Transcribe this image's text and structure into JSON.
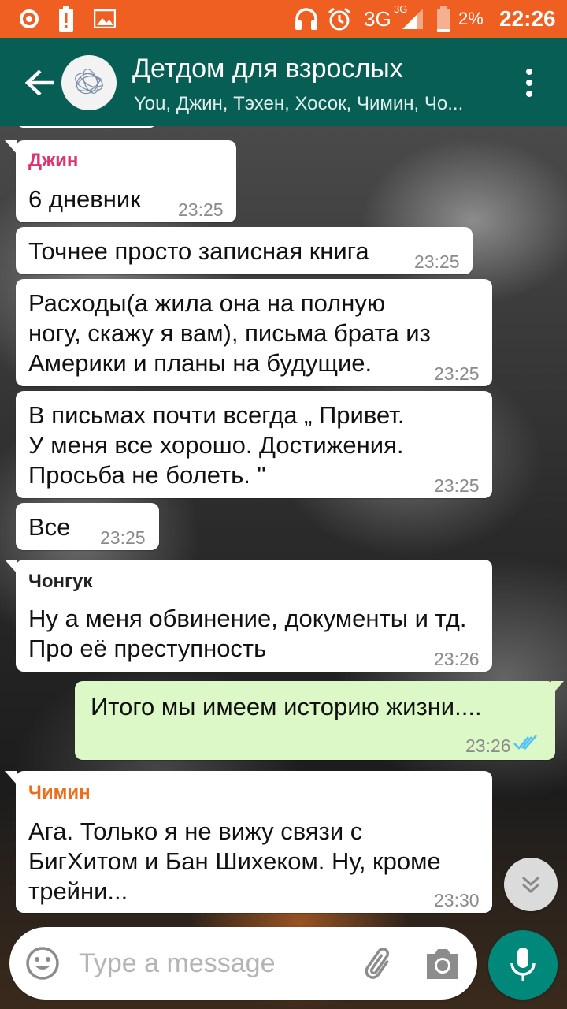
{
  "status_bar": {
    "network": "3G",
    "network_sup": "3G",
    "battery": "2%",
    "time": "22:26"
  },
  "chat": {
    "title": "Детдом для взрослых",
    "participants": "You, Джин, Тэхен, Хосок, Чимин, Чо..."
  },
  "messages": [
    {
      "sender": "Джин",
      "sender_color": "#e0336e",
      "lines": [
        "6 дневник"
      ],
      "time": "23:25"
    },
    {
      "lines": [
        "Точнее просто записная книга"
      ],
      "time": "23:25"
    },
    {
      "lines": [
        "Расходы(а жила она на полную",
        "ногу, скажу я вам), письма брата из",
        "Америки и планы на будущие."
      ],
      "time": "23:25"
    },
    {
      "lines": [
        "В письмах почти всегда „ Привет.",
        "У меня все хорошо. Достижения.",
        "Просьба не болеть. \""
      ],
      "time": "23:25"
    },
    {
      "lines": [
        "Все"
      ],
      "time": "23:25"
    },
    {
      "sender": "Чонгук",
      "sender_color": "#222222",
      "lines": [
        "Ну а меня обвинение, документы и тд.",
        "Про её преступность"
      ],
      "time": "23:26"
    },
    {
      "outgoing": true,
      "lines": [
        "Итого мы имеем историю жизни...."
      ],
      "time": "23:26",
      "status": "read"
    },
    {
      "sender": "Чимин",
      "sender_color": "#ef6c1a",
      "lines": [
        "Ага. Только я не вижу связи с",
        "БигХитом и Бан Шихеком. Ну, кроме",
        "трейни..."
      ],
      "time": "23:30"
    }
  ],
  "composer": {
    "placeholder": "Type a message"
  },
  "colors": {
    "status_bar": "#ef5f22",
    "header": "#075e54",
    "outgoing_bubble": "#dcf8c6",
    "mic_button": "#00897b",
    "read_ticks": "#4fc3f7"
  }
}
